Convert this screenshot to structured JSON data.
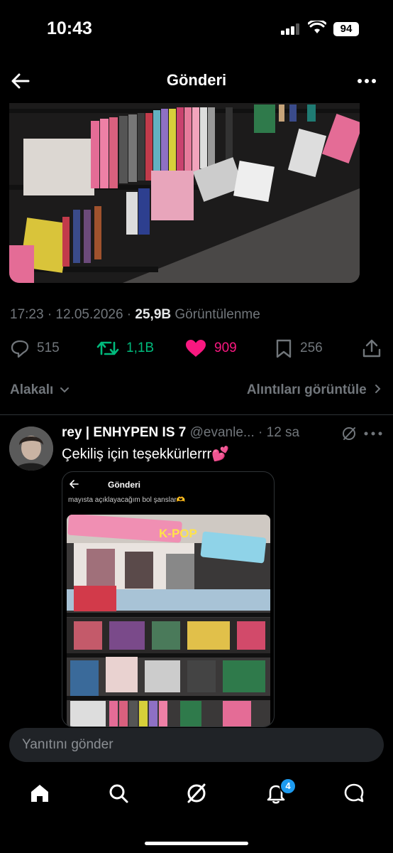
{
  "status_bar": {
    "time": "10:43",
    "battery": "94"
  },
  "header": {
    "title": "Gönderi",
    "back_icon": "arrow-left-icon",
    "more_icon": "more-horizontal-icon"
  },
  "post": {
    "timestamp": "17:23 · 12.05.2026 · ",
    "views_count": "25,9B",
    "views_label": " Görüntülenme",
    "replies": "515",
    "reposts": "1,1B",
    "likes": "909",
    "bookmarks": "256",
    "colors": {
      "repost": "#00ba7c",
      "like": "#f91880",
      "muted": "#71767b"
    }
  },
  "sort": {
    "left": "Alakalı",
    "right": "Alıntıları görüntüle"
  },
  "reply": {
    "name": "rey | ENHYPEN IS 7",
    "handle": " @evanle...",
    "time": " · 12 sa",
    "text": "Çekiliş için teşekkürlerrr💕",
    "embed": {
      "title": "Gönderi",
      "caption": "mayısta açıklayacağım bol şanslar🫶",
      "banner_text": "K-POP"
    }
  },
  "composer": {
    "placeholder": "Yanıtını gönder"
  },
  "tabbar": {
    "notification_count": "4",
    "accent": "#1d9bf0"
  }
}
